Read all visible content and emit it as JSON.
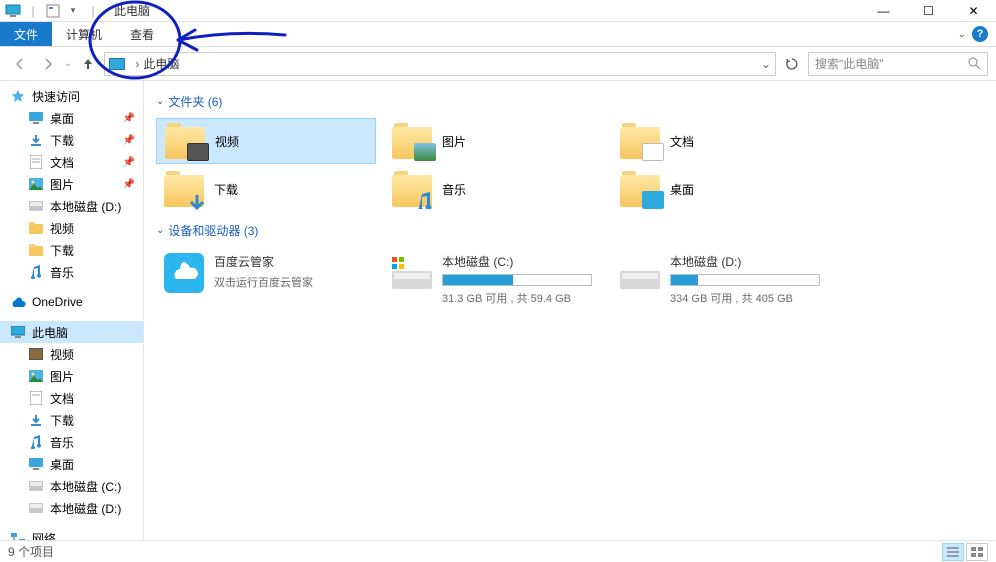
{
  "window": {
    "title": "此电脑",
    "min": "—",
    "max": "☐",
    "close": "✕"
  },
  "ribbon": {
    "file": "文件",
    "computer": "计算机",
    "view": "查看"
  },
  "address": {
    "crumb": "此电脑",
    "dropdown": "⌄"
  },
  "search": {
    "placeholder": "搜索\"此电脑\""
  },
  "sidebar": {
    "quick_access": "快速访问",
    "desktop": "桌面",
    "downloads": "下载",
    "documents": "文档",
    "pictures": "图片",
    "local_d": "本地磁盘 (D:)",
    "video": "视频",
    "downloads2": "下载",
    "music": "音乐",
    "onedrive": "OneDrive",
    "this_pc": "此电脑",
    "pc_video": "视频",
    "pc_pictures": "图片",
    "pc_documents": "文档",
    "pc_downloads": "下载",
    "pc_music": "音乐",
    "pc_desktop": "桌面",
    "pc_local_c": "本地磁盘 (C:)",
    "pc_local_d": "本地磁盘 (D:)",
    "network": "网络"
  },
  "content": {
    "folders_header": "文件夹 (6)",
    "devices_header": "设备和驱动器 (3)",
    "folders": [
      {
        "label": "视频"
      },
      {
        "label": "图片"
      },
      {
        "label": "文档"
      },
      {
        "label": "下载"
      },
      {
        "label": "音乐"
      },
      {
        "label": "桌面"
      }
    ],
    "devices": {
      "baidu": {
        "name": "百度云管家",
        "sub": "双击运行百度云管家"
      },
      "c": {
        "name": "本地磁盘 (C:)",
        "text": "31.3 GB 可用 , 共 59.4 GB",
        "fill_pct": 47
      },
      "d": {
        "name": "本地磁盘 (D:)",
        "text": "334 GB 可用 , 共 405 GB",
        "fill_pct": 18
      }
    }
  },
  "status": {
    "items": "9 个项目"
  }
}
